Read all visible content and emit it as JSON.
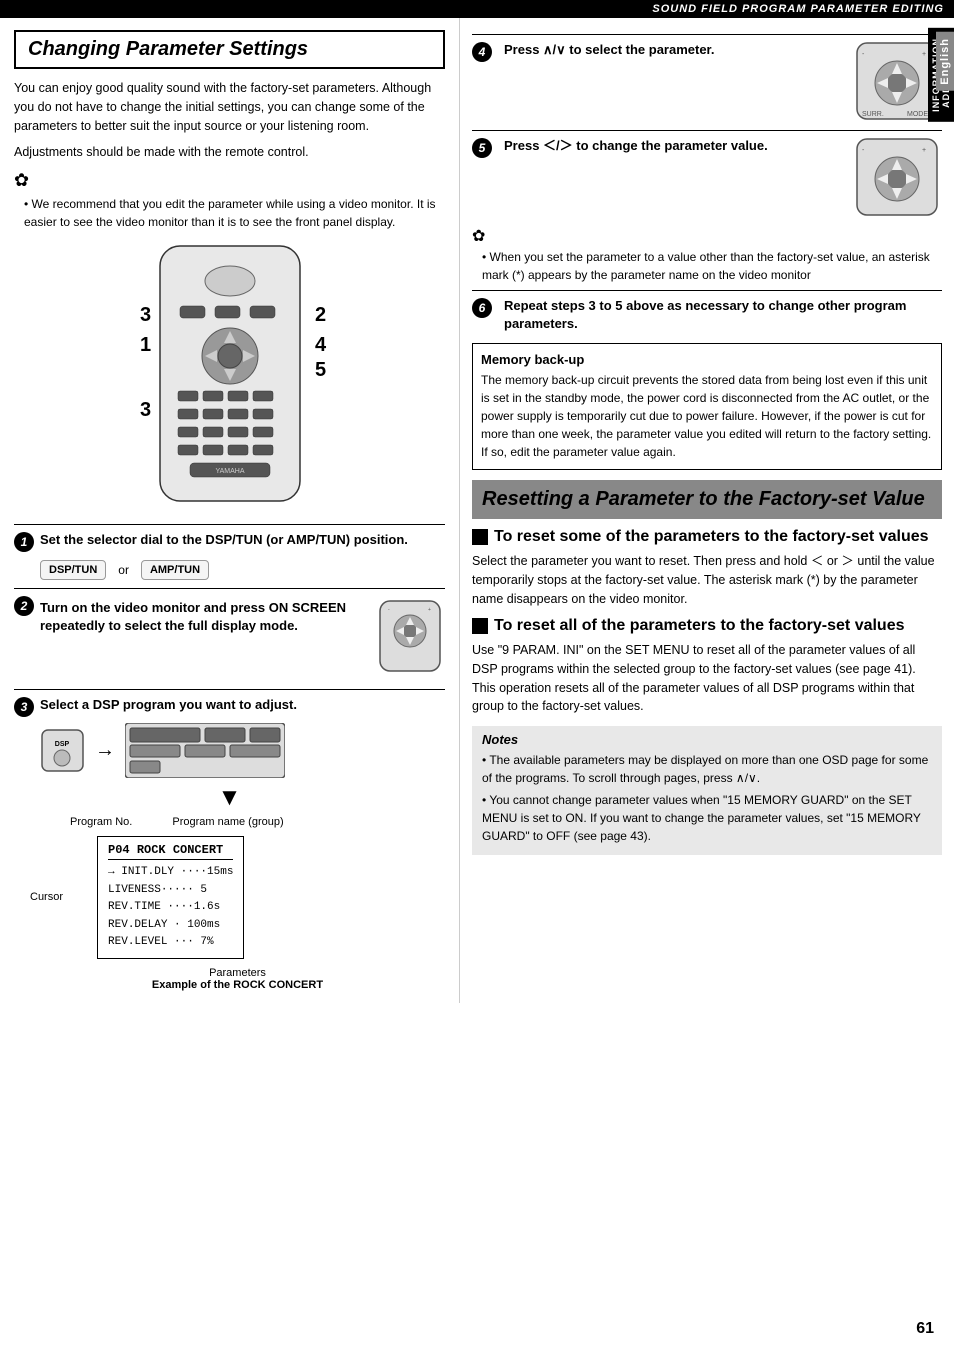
{
  "header": {
    "title": "SOUND FIELD PROGRAM PARAMETER EDITING"
  },
  "left_section": {
    "title": "Changing Parameter Settings",
    "intro": "You can enjoy good quality sound with the factory-set parameters. Although you do not have to change the initial settings, you can change some of the parameters to better suit the input source or your listening room.",
    "adjustment_note": "Adjustments should be made with the remote control.",
    "tip_note": "We recommend that you edit the parameter while using a video monitor. It is easier to see the video monitor than it is to see the front panel display.",
    "step_labels_on_remote": [
      "3",
      "1",
      "2",
      "4",
      "5",
      "3"
    ],
    "step1": {
      "number": "1",
      "text": "Set the selector dial to the DSP/TUN (or AMP/TUN) position.",
      "dial1": "DSP/TUN",
      "or": "or",
      "dial2": "AMP/TUN"
    },
    "step2": {
      "number": "2",
      "text": "Turn on the video monitor and press ON SCREEN repeatedly to select the full display mode."
    },
    "step3": {
      "number": "3",
      "text": "Select a DSP program you want to adjust."
    },
    "program_display": {
      "labels": [
        "Program No.",
        "Program name (group)"
      ],
      "cursor_label": "Cursor",
      "title": "P04 ROCK CONCERT",
      "rows": [
        "→ INIT.DLY ····15ms",
        "LIVENESS·····  5",
        "REV.TIME ····1.6s",
        "REV.DELAY · 100ms",
        "REV.LEVEL ···  7%"
      ],
      "params_label": "Parameters",
      "example_label": "Example of the ROCK CONCERT"
    }
  },
  "right_section": {
    "step4": {
      "number": "4",
      "text": "Press ∧/∨ to select the parameter."
    },
    "step5": {
      "number": "5",
      "text": "Press ＜/＞ to change the parameter value."
    },
    "tip_note2": "When you set the parameter to a value other than the factory-set value, an asterisk mark (*) appears by the parameter name on the video monitor",
    "step6": {
      "number": "6",
      "text": "Repeat steps 3 to 5 above as necessary to change other program parameters."
    },
    "memory_backup": {
      "title": "Memory back-up",
      "text": "The memory back-up circuit prevents the stored data from being lost even if this unit is set in the standby mode, the power cord is disconnected from the AC outlet, or the power supply is temporarily cut due to power failure. However, if the power is cut for more than one week, the parameter value you edited will return to the factory setting. If so, edit the parameter value again."
    },
    "reset_section": {
      "title": "Resetting a Parameter to the Factory-set Value",
      "subsection1_title": "To reset some of the parameters to the factory-set values",
      "subsection1_text": "Select the parameter you want to reset. Then press and hold ＜ or ＞ until the value temporarily stops at the factory-set value. The asterisk mark (*) by the parameter name disappears on the video monitor.",
      "subsection2_title": "To reset all of the parameters to the factory-set values",
      "subsection2_text": "Use \"9 PARAM. INI\" on the SET MENU to reset all of the parameter values of all DSP programs within the selected group to the factory-set values (see page 41). This operation resets all of the parameter values of all DSP programs within that group to the factory-set values."
    },
    "notes": {
      "title": "Notes",
      "items": [
        "The available parameters may be displayed on more than one OSD page for some of the programs. To scroll through pages, press ∧/∨.",
        "You cannot change parameter values when \"15 MEMORY GUARD\" on the SET MENU is set to ON. If you want to change the parameter values, set \"15 MEMORY GUARD\" to OFF (see page 43)."
      ]
    }
  },
  "side_tabs": {
    "additional_info": "ADDITIONAL INFORMATION",
    "english": "English"
  },
  "page_number": "61"
}
